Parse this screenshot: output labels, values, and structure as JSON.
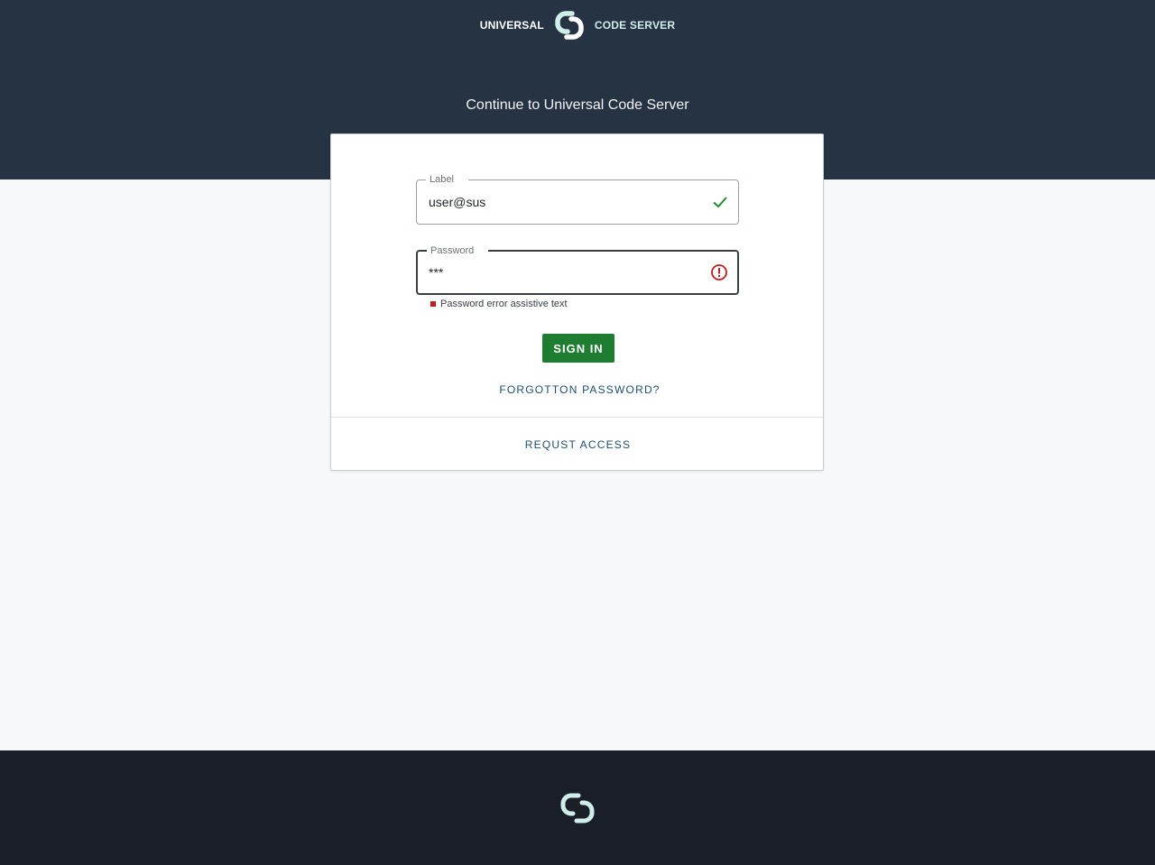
{
  "header": {
    "brand_left": "UNIVERSAL",
    "brand_right": "CODE SERVER",
    "logo_icon": "link-logo-icon",
    "heading": "Continue to Universal Code Server"
  },
  "form": {
    "email": {
      "label": "Label",
      "value": "user@sus",
      "status_icon": "check-icon",
      "status_color": "#1f8a2e"
    },
    "password": {
      "label": "Password",
      "value": "***",
      "status_icon": "error-circle-icon",
      "status_color": "#c21c1c",
      "assistive_text": "Password error assistive text"
    },
    "sign_in_label": "SIGN IN",
    "forgot_label": "FORGOTTON PASSWORD?",
    "request_label": "REQUST ACCESS"
  },
  "footer": {
    "logo_icon": "link-logo-icon"
  },
  "colors": {
    "header_bg": "#263343",
    "footer_bg": "#1a1f27",
    "accent_green": "#1f7d32",
    "link_blue": "#1d4f6e",
    "logo_mint": "#cfeee9"
  }
}
